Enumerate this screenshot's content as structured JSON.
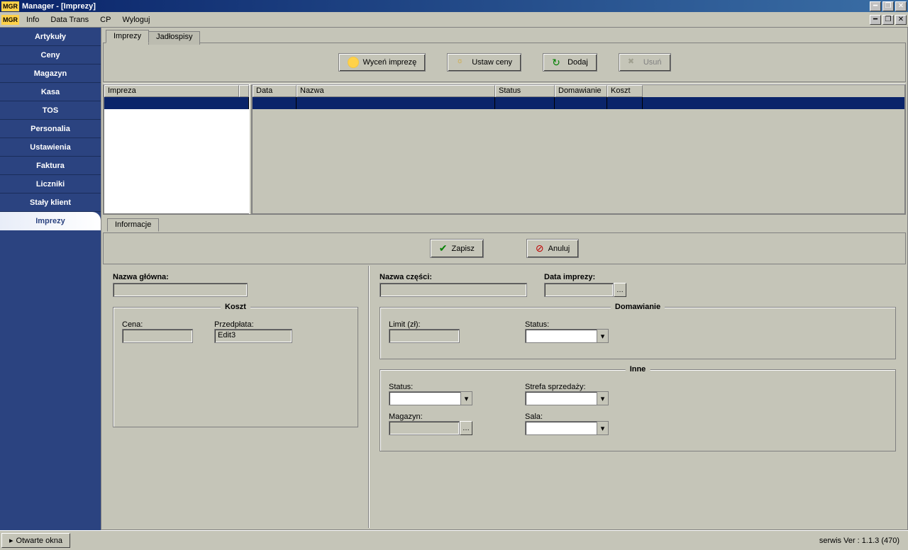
{
  "window": {
    "title": "Manager - [Imprezy]",
    "badge": "MGR"
  },
  "menu": {
    "badge": "MGR",
    "items": [
      "Info",
      "Data Trans",
      "CP",
      "Wyloguj"
    ]
  },
  "sidebar": {
    "items": [
      {
        "label": "Artykuły"
      },
      {
        "label": "Ceny"
      },
      {
        "label": "Magazyn"
      },
      {
        "label": "Kasa"
      },
      {
        "label": "TOS"
      },
      {
        "label": "Personalia"
      },
      {
        "label": "Ustawienia"
      },
      {
        "label": "Faktura"
      },
      {
        "label": "Liczniki"
      },
      {
        "label": "Stały klient"
      },
      {
        "label": "Imprezy"
      }
    ],
    "active": 10
  },
  "tabs": {
    "main": [
      {
        "label": "Imprezy"
      },
      {
        "label": "Jadłospisy"
      }
    ],
    "active": 0
  },
  "toolbar": {
    "price_event": "Wyceń imprezę",
    "set_prices": "Ustaw ceny",
    "add": "Dodaj",
    "delete": "Usuń"
  },
  "grid_left": {
    "headers": [
      "Impreza"
    ]
  },
  "grid_right": {
    "headers": [
      "Data",
      "Nazwa",
      "Status",
      "Domawianie",
      "Koszt"
    ]
  },
  "info_tab": {
    "label": "Informacje"
  },
  "actions": {
    "save": "Zapisz",
    "cancel": "Anuluj"
  },
  "form_left": {
    "main_name": "Nazwa główna:",
    "koszt_group": "Koszt",
    "cena": "Cena:",
    "przedplata": "Przedpłata:",
    "przedplata_value": "Edit3"
  },
  "form_right": {
    "part_name": "Nazwa części:",
    "event_date": "Data imprezy:",
    "domawianie_group": "Domawianie",
    "limit": "Limit (zł):",
    "status": "Status:",
    "inne_group": "Inne",
    "status2": "Status:",
    "strefa": "Strefa sprzedaży:",
    "magazyn": "Magazyn:",
    "sala": "Sala:"
  },
  "status": {
    "open_windows": "Otwarte okna",
    "right": "serwis  Ver : 1.1.3 (470)"
  }
}
